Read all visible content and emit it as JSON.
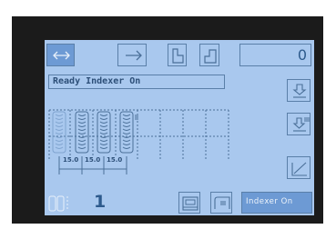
{
  "top_bar": {
    "counter_value": "0"
  },
  "status": {
    "message": "Ready Indexer On"
  },
  "layout": {
    "dimensions": [
      "15.0",
      "15.0",
      "15.0"
    ]
  },
  "bottom_bar": {
    "count_value": "1",
    "indexer_button_label": "Indexer On"
  },
  "colors": {
    "screen_bg": "#a9c8ee",
    "selected_bg": "#6d9ad4",
    "line": "#4a6f98",
    "bezel": "#1b1b1b"
  }
}
